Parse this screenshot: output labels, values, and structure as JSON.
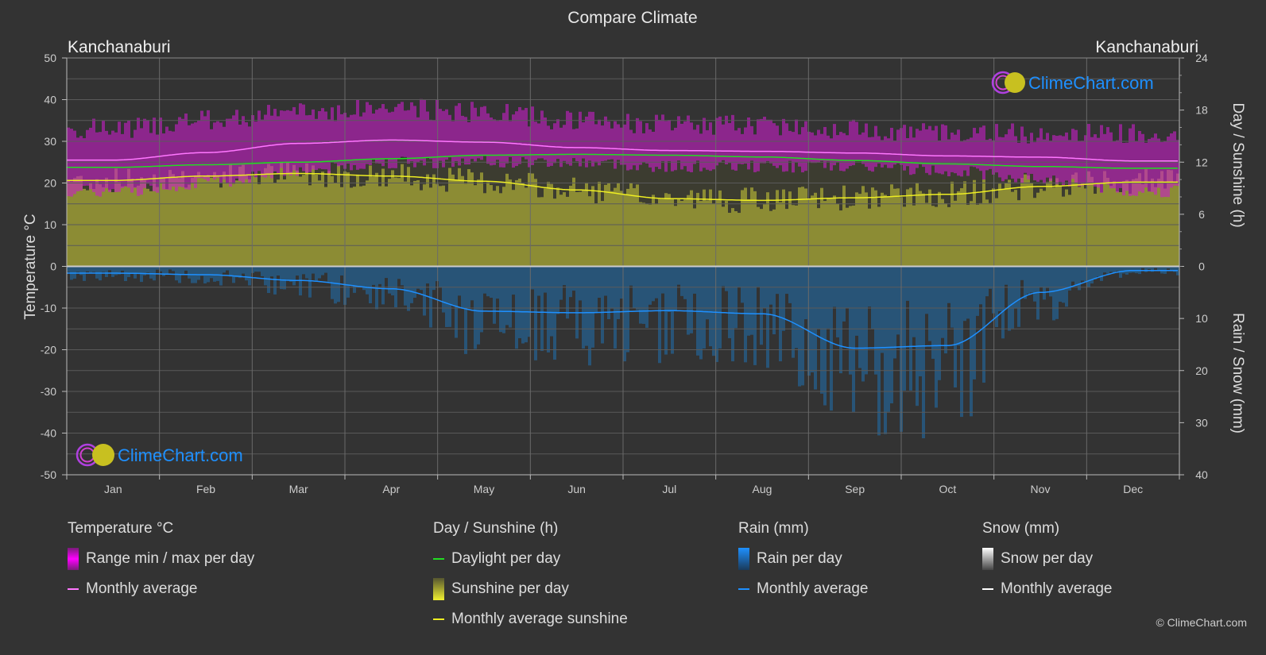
{
  "title": "Compare Climate",
  "location_left": "Kanchanaburi",
  "location_right": "Kanchanaburi",
  "watermark": "ClimeChart.com",
  "copyright": "© ClimeChart.com",
  "colors": {
    "background": "#333333",
    "temp_range": "#c81ec8",
    "temp_avg": "#ff77ff",
    "daylight": "#22dd22",
    "sunshine_fill": "#9a9a35",
    "sunshine_avg": "#eeee22",
    "rain_fill": "#1f6fae",
    "rain_avg": "#1e90ff",
    "snow_avg": "#ffffff",
    "watermark_text": "#1e90ff"
  },
  "legend": {
    "temperature": {
      "heading": "Temperature °C",
      "items": [
        "Range min / max per day",
        "Monthly average"
      ]
    },
    "sunshine": {
      "heading": "Day / Sunshine (h)",
      "items": [
        "Daylight per day",
        "Sunshine per day",
        "Monthly average sunshine"
      ]
    },
    "rain": {
      "heading": "Rain (mm)",
      "items": [
        "Rain per day",
        "Monthly average"
      ]
    },
    "snow": {
      "heading": "Snow (mm)",
      "items": [
        "Snow per day",
        "Monthly average"
      ]
    }
  },
  "chart_data": {
    "type": "area",
    "title": "Compare Climate",
    "categories": [
      "Jan",
      "Feb",
      "Mar",
      "Apr",
      "May",
      "Jun",
      "Jul",
      "Aug",
      "Sep",
      "Oct",
      "Nov",
      "Dec"
    ],
    "left_axis": {
      "label": "Temperature °C",
      "range": [
        -50,
        50
      ],
      "ticks": [
        50,
        40,
        30,
        20,
        10,
        0,
        -10,
        -20,
        -30,
        -40,
        -50
      ]
    },
    "right_axis_top": {
      "label": "Day / Sunshine (h)",
      "range": [
        0,
        24
      ],
      "ticks": [
        24,
        18,
        12,
        6,
        0
      ]
    },
    "right_axis_bottom": {
      "label": "Rain / Snow (mm)",
      "range": [
        0,
        40
      ],
      "ticks": [
        0,
        10,
        20,
        30,
        40
      ]
    },
    "grid": true,
    "legend_position": "bottom",
    "series": [
      {
        "name": "Temperature monthly average (°C)",
        "values": [
          25.5,
          27.3,
          29.5,
          30.3,
          29.8,
          28.5,
          27.8,
          27.6,
          27.2,
          26.5,
          26.2,
          25.3
        ]
      },
      {
        "name": "Temperature daily max approx (°C)",
        "values": [
          33,
          35,
          37,
          38,
          37,
          35,
          34,
          34,
          33,
          32,
          32,
          32
        ]
      },
      {
        "name": "Temperature daily min approx (°C)",
        "values": [
          18,
          20,
          23,
          25,
          25,
          25,
          24,
          24,
          24,
          23,
          21,
          18
        ]
      },
      {
        "name": "Daylight per day (h)",
        "values": [
          11.4,
          11.7,
          12.0,
          12.4,
          12.8,
          12.9,
          12.8,
          12.6,
          12.2,
          11.8,
          11.5,
          11.3
        ]
      },
      {
        "name": "Monthly average sunshine (h)",
        "values": [
          9.9,
          10.4,
          10.7,
          10.4,
          9.8,
          8.8,
          7.8,
          7.6,
          7.9,
          8.3,
          9.2,
          9.7
        ]
      },
      {
        "name": "Rain monthly average (mm)",
        "values": [
          1.3,
          1.6,
          2.7,
          4.3,
          8.6,
          8.9,
          8.5,
          9.1,
          15.7,
          15.2,
          5.0,
          0.8
        ]
      },
      {
        "name": "Snow monthly average (mm)",
        "values": [
          0,
          0,
          0,
          0,
          0,
          0,
          0,
          0,
          0,
          0,
          0,
          0
        ]
      }
    ]
  }
}
